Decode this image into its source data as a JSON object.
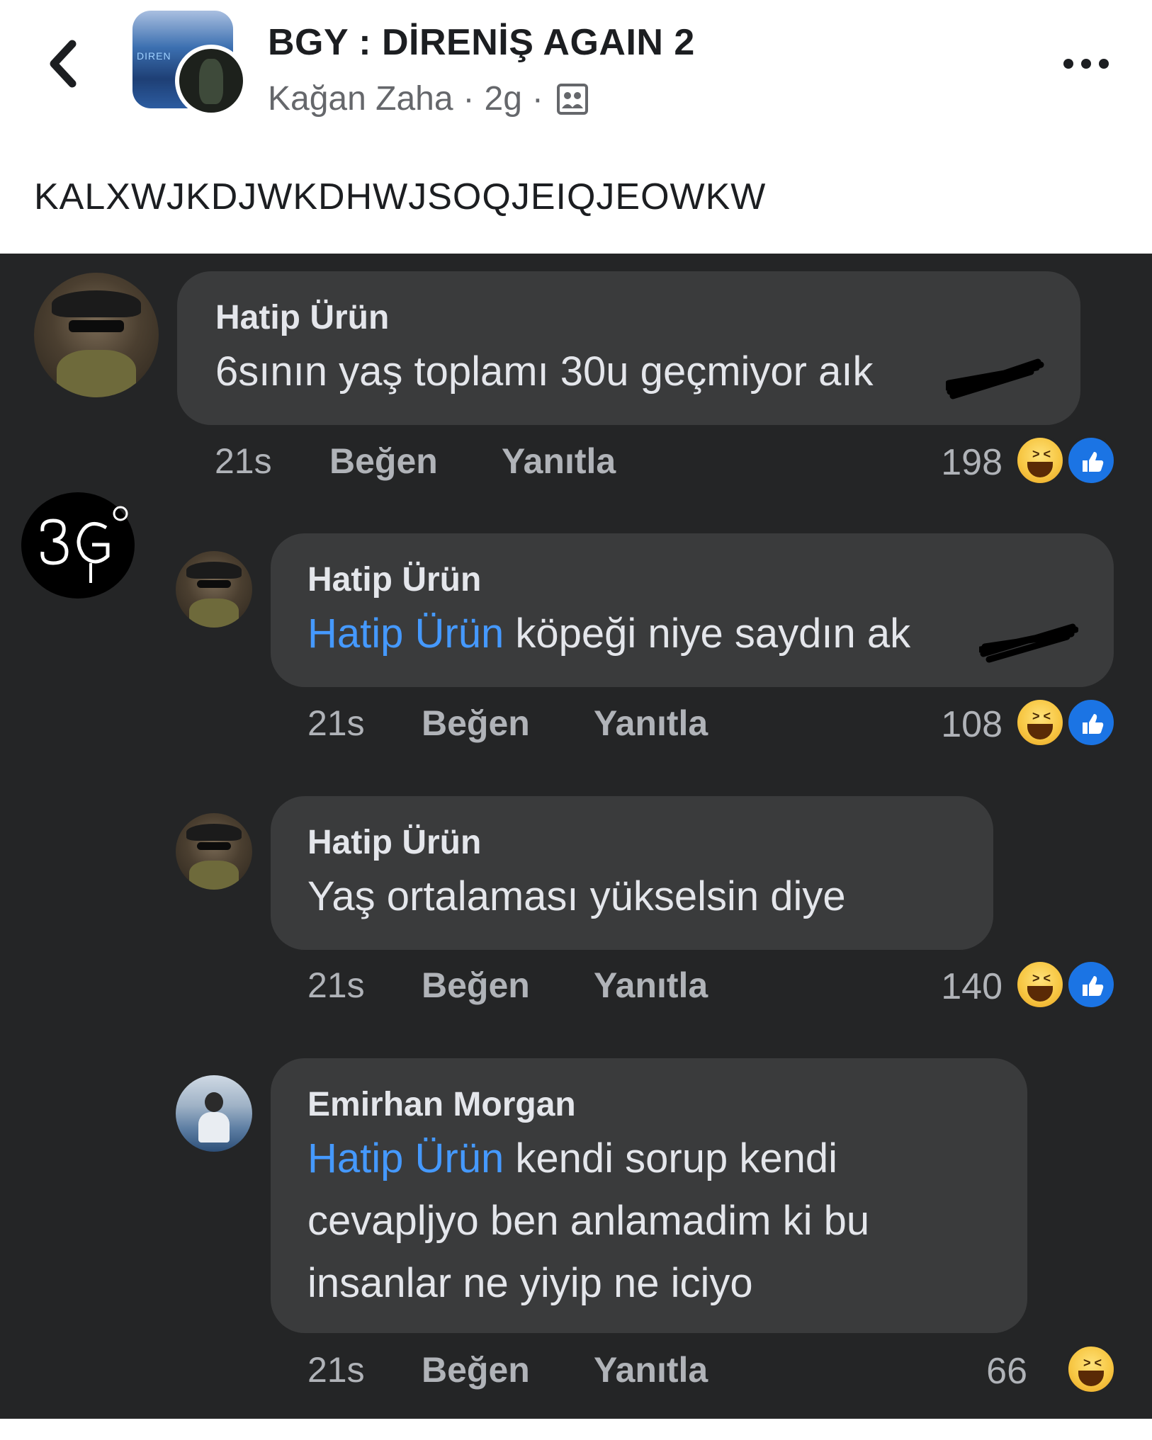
{
  "post": {
    "group_title": "BGY : DİRENİŞ AGAIN 2",
    "author": "Kağan Zaha",
    "time": "2g",
    "separator": "·",
    "text": "KALXWJKDJWKDHWJSOQJEIQJEOWKW",
    "group_avatar_tag": "DIREN"
  },
  "logo": {
    "text": "BG"
  },
  "comments": [
    {
      "name": "Hatip Ürün",
      "mention": "",
      "text": "6sının yaş toplamı 30u geçmiyor a",
      "text_tail": "ık",
      "time": "21s",
      "like_label": "Beğen",
      "reply_label": "Yanıtla",
      "count": "198"
    },
    {
      "name": "Hatip Ürün",
      "mention": "Hatip Ürün",
      "text": "köpeği niye saydın a",
      "text_tail": "k",
      "time": "21s",
      "like_label": "Beğen",
      "reply_label": "Yanıtla",
      "count": "108"
    },
    {
      "name": "Hatip Ürün",
      "mention": "",
      "text": "Yaş ortalaması yükselsin diye",
      "time": "21s",
      "like_label": "Beğen",
      "reply_label": "Yanıtla",
      "count": "140"
    },
    {
      "name": "Emirhan Morgan",
      "mention": "Hatip Ürün",
      "text_line1": "kendi sorup kendi",
      "text_line2": "cevapljyo ben anlamadim ki bu",
      "text_line3": "insanlar ne yiyip ne iciyo",
      "time": "21s",
      "like_label": "Beğen",
      "reply_label": "Yanıtla",
      "count": "66"
    }
  ],
  "icons": {
    "back": "chevron-left-icon",
    "more": "more-dots-icon",
    "audience": "group-audience-icon",
    "haha": "haha-reaction-icon",
    "like": "like-reaction-icon"
  },
  "colors": {
    "panel_bg": "#242526",
    "bubble_bg": "#3a3b3c",
    "mention": "#4599ff",
    "text_light": "#e4e6eb",
    "text_muted": "#b0b3b8"
  }
}
